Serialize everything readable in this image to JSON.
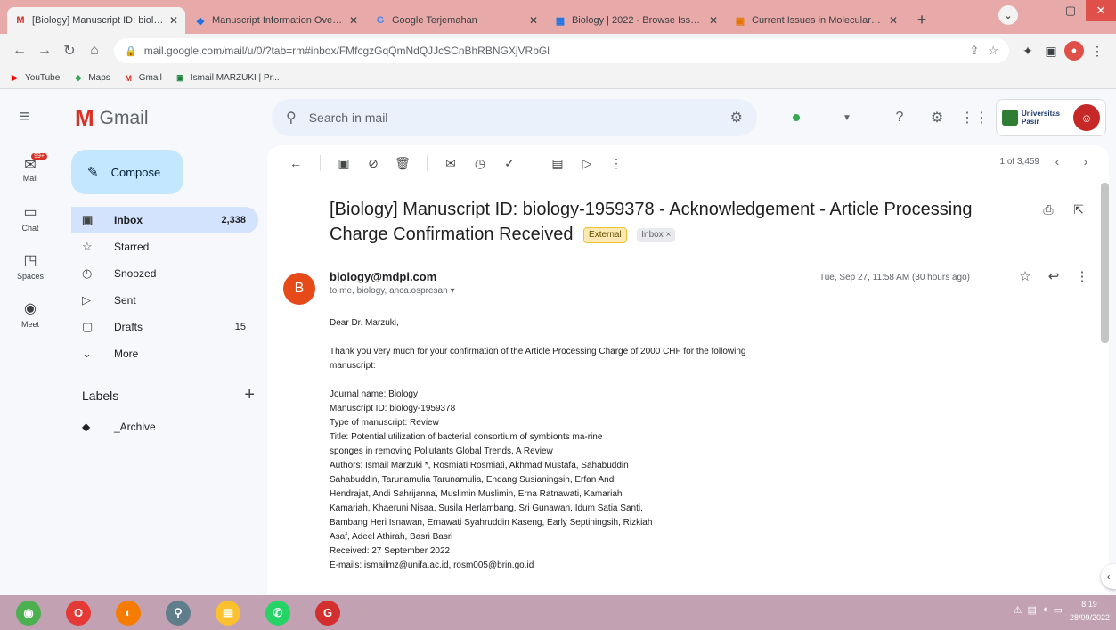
{
  "browser": {
    "tabs": [
      {
        "icon": "M",
        "color": "#d93025",
        "title": "[Biology] Manuscript ID: biolo...",
        "active": true
      },
      {
        "icon": "◆",
        "color": "#1a73e8",
        "title": "Manuscript Information Overv...",
        "active": false
      },
      {
        "icon": "G",
        "color": "#4285f4",
        "title": "Google Terjemahan",
        "active": false
      },
      {
        "icon": "▦",
        "color": "#1a73e8",
        "title": "Biology | 2022 - Browse Issues",
        "active": false
      },
      {
        "icon": "▣",
        "color": "#e37400",
        "title": "Current Issues in Molecular Bi...",
        "active": false
      }
    ],
    "url": "mail.google.com/mail/u/0/?tab=rm#inbox/FMfcgzGqQmNdQJJcSCnBhRBNGXjVRbGl",
    "bookmarks": [
      {
        "icon": "▶",
        "color": "#ff0000",
        "label": "YouTube"
      },
      {
        "icon": "◆",
        "color": "#34a853",
        "label": "Maps"
      },
      {
        "icon": "M",
        "color": "#d93025",
        "label": "Gmail"
      },
      {
        "icon": "▣",
        "color": "#188038",
        "label": "Ismail MARZUKI | Pr..."
      }
    ]
  },
  "gmail": {
    "app_name": "Gmail",
    "search_placeholder": "Search in mail",
    "org_name": "Universitas Pasir",
    "compose_label": "Compose",
    "rail": [
      {
        "icon": "✉",
        "label": "Mail",
        "badge": "99+"
      },
      {
        "icon": "▭",
        "label": "Chat"
      },
      {
        "icon": "◳",
        "label": "Spaces"
      },
      {
        "icon": "◉",
        "label": "Meet"
      }
    ],
    "nav": [
      {
        "icon": "▣",
        "label": "Inbox",
        "count": "2,338",
        "selected": true
      },
      {
        "icon": "☆",
        "label": "Starred",
        "count": ""
      },
      {
        "icon": "◷",
        "label": "Snoozed",
        "count": ""
      },
      {
        "icon": "▷",
        "label": "Sent",
        "count": ""
      },
      {
        "icon": "▢",
        "label": "Drafts",
        "count": "15"
      },
      {
        "icon": "⌄",
        "label": "More",
        "count": ""
      }
    ],
    "labels_heading": "Labels",
    "label_items": [
      {
        "label": "_Archive"
      }
    ],
    "pager": "1 of 3,459"
  },
  "email": {
    "subject": "[Biology] Manuscript ID: biology-1959378 - Acknowledgement - Article Processing Charge Confirmation Received",
    "tag_external": "External",
    "tag_inbox": "Inbox ×",
    "sender_initial": "B",
    "sender": "biology@mdpi.com",
    "recipients": "to me, biology, anca.ospresan ▾",
    "date": "Tue, Sep 27, 11:58 AM (30 hours ago)",
    "greeting": "Dear Dr. Marzuki,",
    "intro": "Thank you very much for your confirmation of the Article Processing Charge of 2000 CHF for the following manuscript:",
    "details": [
      "Journal name: Biology",
      "Manuscript ID: biology-1959378",
      "Type of manuscript: Review",
      "Title: Potential utilization of bacterial consortium of symbionts ma-rine",
      "sponges in removing Pollutants Global Trends, A Review",
      "Authors: Ismail Marzuki *, Rosmiati Rosmiati, Akhmad Mustafa, Sahabuddin",
      "Sahabuddin, Tarunamulia Tarunamulia, Endang Susianingsih, Erfan Andi",
      "Hendrajat, Andi Sahrijanna, Muslimin Muslimin, Erna Ratnawati, Kamariah",
      "Kamariah, Khaeruni Nisaa, Susila Herlambang, Sri Gunawan, Idum Satia Santi,",
      "Bambang Heri Isnawan, Ernawati Syahruddin Kaseng, Early Septiningsih, Rizkiah",
      "Asaf, Adeel Athirah, Basri Basri",
      "Received: 27 September 2022",
      "E-mails: ismailmz@unifa.ac.id, rosm005@brin.go.id"
    ]
  },
  "taskbar": {
    "apps": [
      {
        "icon": "◉",
        "color": "#4caf50"
      },
      {
        "icon": "O",
        "color": "#e53935"
      },
      {
        "icon": "◐",
        "color": "#f57c00"
      },
      {
        "icon": "⚲",
        "color": "#607d8b"
      },
      {
        "icon": "▤",
        "color": "#fbc02d"
      },
      {
        "icon": "✆",
        "color": "#25d366"
      },
      {
        "icon": "G",
        "color": "#d32f2f"
      }
    ],
    "time": "8:19",
    "date": "28/09/2022"
  }
}
